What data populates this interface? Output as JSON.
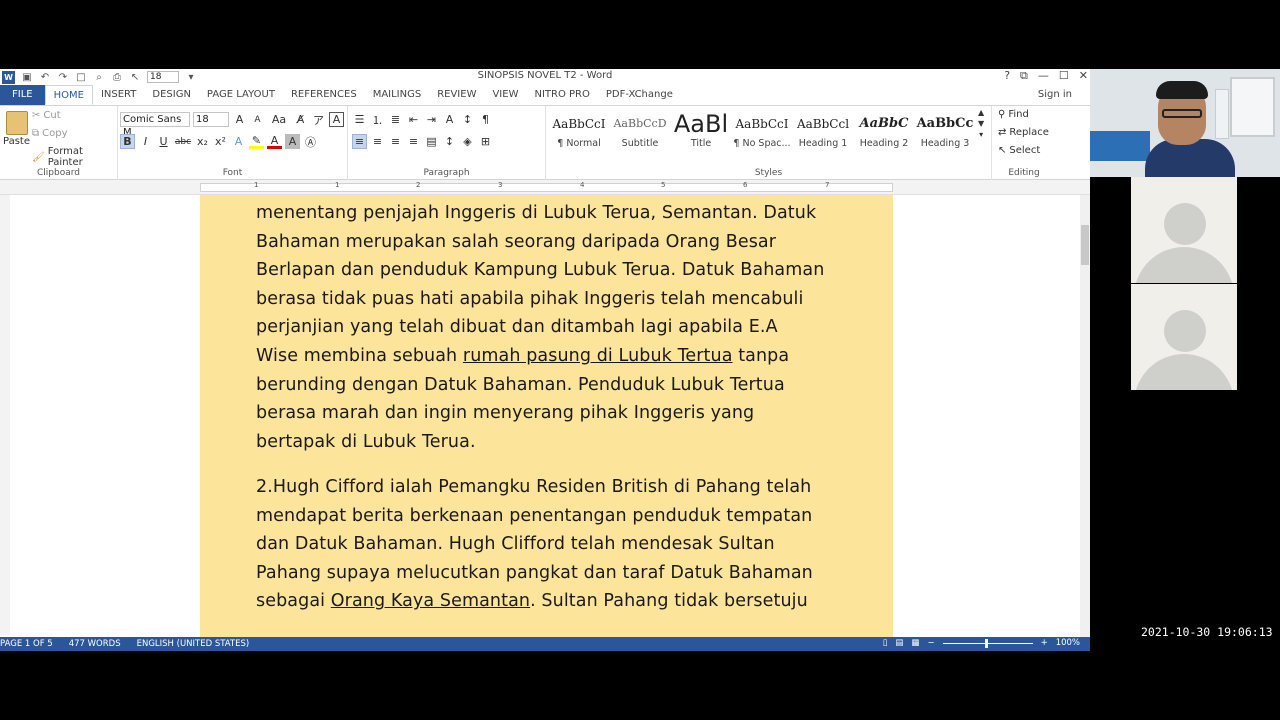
{
  "window": {
    "title": "SINOPSIS NOVEL T2 - Word",
    "font_size_qat": "18",
    "controls": [
      "?",
      "⧉",
      "—",
      "☐",
      "✕"
    ]
  },
  "tabs": [
    "FILE",
    "HOME",
    "INSERT",
    "DESIGN",
    "PAGE LAYOUT",
    "REFERENCES",
    "MAILINGS",
    "REVIEW",
    "VIEW",
    "NITRO PRO",
    "PDF-XChange"
  ],
  "active_tab": "HOME",
  "signin": "Sign in",
  "ribbon": {
    "clipboard": {
      "paste": "Paste",
      "cut": "Cut",
      "copy": "Copy",
      "format_painter": "Format Painter",
      "label": "Clipboard"
    },
    "font": {
      "name": "Comic Sans M",
      "size": "18",
      "label": "Font"
    },
    "paragraph": {
      "label": "Paragraph"
    },
    "styles": {
      "label": "Styles",
      "items": [
        {
          "sample": "AaBbCcI",
          "name": "¶ Normal"
        },
        {
          "sample": "AaBbCcD",
          "name": "Subtitle"
        },
        {
          "sample": "AaBl",
          "name": "Title"
        },
        {
          "sample": "AaBbCcI",
          "name": "¶ No Spac..."
        },
        {
          "sample": "AaBbCcl",
          "name": "Heading 1"
        },
        {
          "sample": "AaBbC",
          "name": "Heading 2"
        },
        {
          "sample": "AaBbCc",
          "name": "Heading 3"
        }
      ]
    },
    "editing": {
      "find": "Find",
      "replace": "Replace",
      "select": "Select",
      "label": "Editing"
    }
  },
  "ruler": {
    "numbers": [
      "1",
      "1",
      "2",
      "3",
      "4",
      "5",
      "6",
      "7"
    ]
  },
  "document": {
    "para1": {
      "lines": [
        "menentang penjajah Inggeris di Lubuk Terua, Semantan. Datuk",
        "Bahaman  merupakan salah seorang daripada Orang Besar",
        "Berlapan dan penduduk Kampung Lubuk Terua. Datuk Bahaman",
        "berasa tidak puas hati apabila pihak Inggeris telah mencabuli",
        "perjanjian yang telah dibuat dan ditambah lagi apabila E.A"
      ],
      "line6_pre": "Wise membina sebuah ",
      "line6_u": "rumah pasung di Lubuk Tertua",
      "line6_post": " tanpa",
      "lines_after": [
        "berunding dengan Datuk Bahaman. Penduduk Lubuk Tertua",
        "berasa marah dan ingin menyerang pihak Inggeris yang",
        "bertapak di Lubuk Terua."
      ]
    },
    "para2": {
      "lines": [
        "2.Hugh Cifford ialah Pemangku Residen British di Pahang telah",
        "mendapat berita berkenaan penentangan penduduk tempatan",
        "dan Datuk Bahaman.  Hugh Clifford telah mendesak Sultan",
        "Pahang supaya melucutkan pangkat dan taraf Datuk Bahaman"
      ],
      "line5_pre": "sebagai ",
      "line5_u": "Orang Kaya Semantan",
      "line5_post": ". Sultan Pahang tidak bersetuju"
    }
  },
  "status": {
    "page": "PAGE 1 OF 5",
    "words": "477 WORDS",
    "language": "ENGLISH (UNITED STATES)",
    "zoom": "100%"
  },
  "timestamp": "2021-10-30  19:06:13"
}
